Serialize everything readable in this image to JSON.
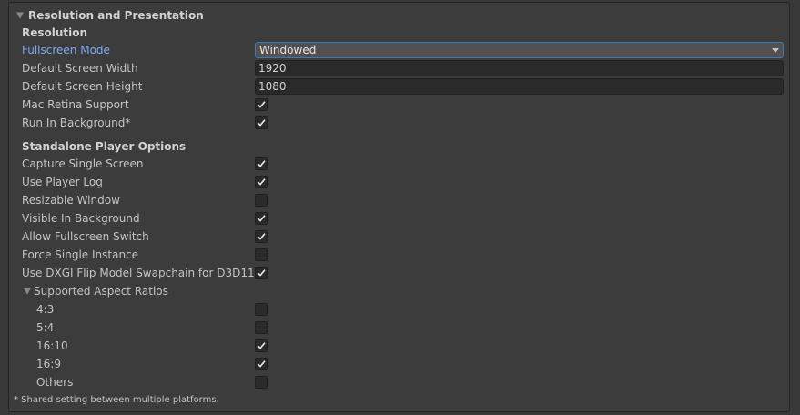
{
  "section": {
    "title": "Resolution and Presentation"
  },
  "resolution": {
    "header": "Resolution",
    "fullscreen_mode": {
      "label": "Fullscreen Mode",
      "value": "Windowed"
    },
    "default_width": {
      "label": "Default Screen Width",
      "value": "1920"
    },
    "default_height": {
      "label": "Default Screen Height",
      "value": "1080"
    },
    "mac_retina": {
      "label": "Mac Retina Support",
      "checked": true
    },
    "run_in_background": {
      "label": "Run In Background*",
      "checked": true
    }
  },
  "standalone": {
    "header": "Standalone Player Options",
    "items": [
      {
        "label": "Capture Single Screen",
        "checked": true
      },
      {
        "label": "Use Player Log",
        "checked": true
      },
      {
        "label": "Resizable Window",
        "checked": false
      },
      {
        "label": "Visible In Background",
        "checked": true
      },
      {
        "label": "Allow Fullscreen Switch",
        "checked": true
      },
      {
        "label": "Force Single Instance",
        "checked": false
      },
      {
        "label": "Use DXGI Flip Model Swapchain for D3D11",
        "checked": true
      }
    ]
  },
  "aspect_ratios": {
    "title": "Supported Aspect Ratios",
    "items": [
      {
        "label": "4:3",
        "checked": false
      },
      {
        "label": "5:4",
        "checked": false
      },
      {
        "label": "16:10",
        "checked": true
      },
      {
        "label": "16:9",
        "checked": true
      },
      {
        "label": "Others",
        "checked": false
      }
    ]
  },
  "footer": {
    "note": "* Shared setting between multiple platforms."
  }
}
